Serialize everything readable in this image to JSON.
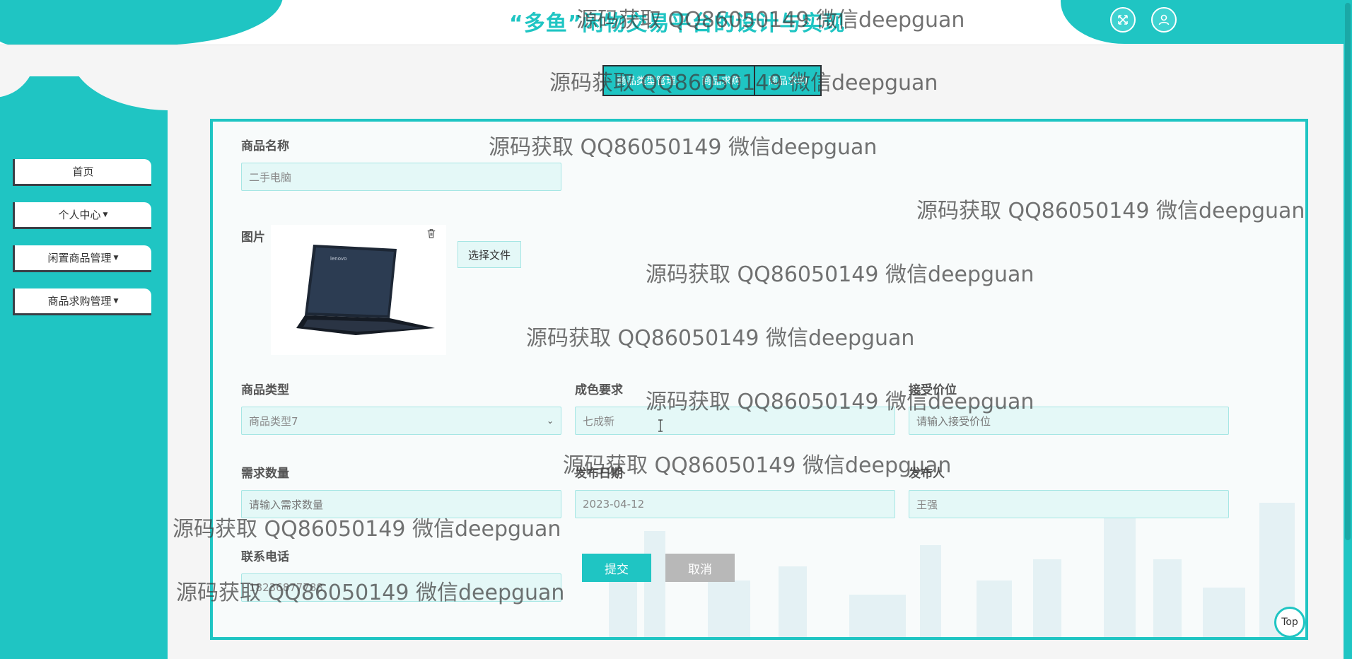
{
  "header": {
    "site_title": "“多鱼”闲物交易平台的设计与实现",
    "fullscreen_icon": "fullscreen-icon",
    "user_icon": "user-icon"
  },
  "tabs": [
    {
      "label": "商品类型管理"
    },
    {
      "label": "商品求购"
    },
    {
      "label": "商品求购"
    }
  ],
  "sidebar": {
    "items": [
      {
        "label": "首页",
        "has_caret": false
      },
      {
        "label": "个人中心",
        "has_caret": true
      },
      {
        "label": "闲置商品管理",
        "has_caret": true
      },
      {
        "label": "商品求购管理",
        "has_caret": true
      }
    ]
  },
  "form": {
    "product_name": {
      "label": "商品名称",
      "value": "二手电脑"
    },
    "image": {
      "label": "图片",
      "choose_file": "选择文件",
      "picture": "laptop-photo",
      "delete_icon": "trash-icon"
    },
    "product_type": {
      "label": "商品类型",
      "value": "商品类型7"
    },
    "condition": {
      "label": "成色要求",
      "value": "七成新"
    },
    "accept_price": {
      "label": "接受价位",
      "placeholder": "请输入接受价位"
    },
    "quantity": {
      "label": "需求数量",
      "placeholder": "请输入需求数量"
    },
    "publish_date": {
      "label": "发布日期",
      "value": "2023-04-12"
    },
    "publisher": {
      "label": "发布人",
      "value": "王强"
    },
    "phone": {
      "label": "联系电话",
      "value": "18236877788"
    },
    "submit": "提交",
    "cancel": "取消"
  },
  "top_button": "Top",
  "watermarks": [
    "源码获取 QQ86050149 微信deepguan",
    "源码获取 QQ86050149 微信deepguan",
    "源码获取 QQ86050149 微信deepguan",
    "源码获取 QQ86050149 微信deepguan",
    "源码获取 QQ86050149 微信deepguan",
    "源码获取 QQ86050149 微信deepguan",
    "源码获取 QQ86050149 微信deepguan",
    "源码获取 QQ86050149 微信deepguan",
    "源码获取 QQ86050149 微信deepguan",
    "源码获取 QQ86050149 微信deepguan"
  ],
  "colors": {
    "accent": "#1fc5c3",
    "sidebar_border": "#3b3f46",
    "cancel": "#b8b8b8"
  }
}
